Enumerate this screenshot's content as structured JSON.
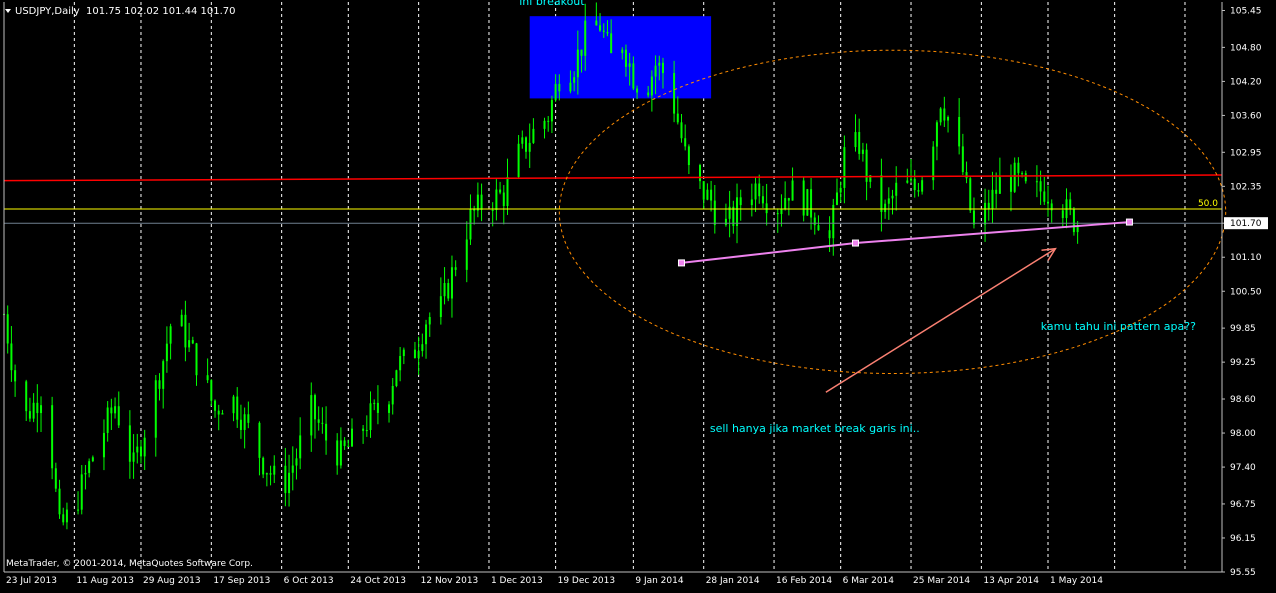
{
  "header": {
    "symbol_label": "USDJPY,Daily",
    "ohlc_label": "101.75 102.02 101.44 101.70"
  },
  "footer": {
    "copyright": "MetaTrader, © 2001-2014, MetaQuotes Software Corp."
  },
  "colors": {
    "background": "#000000",
    "grid": "#ffffff",
    "candles": "#00ff00",
    "breakout_box": "#0000ff",
    "resistance_line": "#ff0000",
    "fib_line": "#ffff00",
    "trendline": "#ee82ee",
    "ellipse": "#ff8c00",
    "arrow": "#fa8072",
    "annotation_text": "#00ffff",
    "axis_text": "#ffffff",
    "price_label_bg": "#ffffff",
    "price_label_text": "#000000"
  },
  "chart_data": {
    "type": "candlestick",
    "symbol": "USDJPY",
    "timeframe": "Daily",
    "ylim": [
      95.55,
      105.6
    ],
    "x_range": [
      "2013-07-23",
      "2014-06-17"
    ],
    "grid": true,
    "y_ticks": [
      "105.45",
      "104.80",
      "104.20",
      "103.60",
      "102.95",
      "102.35",
      "101.70",
      "101.10",
      "100.50",
      "99.85",
      "99.25",
      "98.60",
      "98.00",
      "97.40",
      "96.75",
      "96.15",
      "95.55"
    ],
    "x_ticks": [
      {
        "label": "23 Jul 2013",
        "date": "2013-07-23"
      },
      {
        "label": "11 Aug 2013",
        "date": "2013-08-11"
      },
      {
        "label": "29 Aug 2013",
        "date": "2013-08-29"
      },
      {
        "label": "17 Sep 2013",
        "date": "2013-09-17"
      },
      {
        "label": "6 Oct 2013",
        "date": "2013-10-06"
      },
      {
        "label": "24 Oct 2013",
        "date": "2013-10-24"
      },
      {
        "label": "12 Nov 2013",
        "date": "2013-11-12"
      },
      {
        "label": "1 Dec 2013",
        "date": "2013-12-01"
      },
      {
        "label": "19 Dec 2013",
        "date": "2013-12-19"
      },
      {
        "label": "9 Jan 2014",
        "date": "2014-01-09"
      },
      {
        "label": "28 Jan 2014",
        "date": "2014-01-28"
      },
      {
        "label": "16 Feb 2014",
        "date": "2014-02-16"
      },
      {
        "label": "6 Mar 2014",
        "date": "2014-03-06"
      },
      {
        "label": "25 Mar 2014",
        "date": "2014-03-25"
      },
      {
        "label": "13 Apr 2014",
        "date": "2014-04-13"
      },
      {
        "label": "1 May 2014",
        "date": "2014-05-01"
      }
    ],
    "current_price": "101.70",
    "price_path": [
      [
        "2013-07-23",
        100.1
      ],
      [
        "2013-07-28",
        98.2
      ],
      [
        "2013-08-03",
        98.8
      ],
      [
        "2013-08-07",
        96.3
      ],
      [
        "2013-08-11",
        96.7
      ],
      [
        "2013-08-16",
        97.6
      ],
      [
        "2013-08-22",
        98.5
      ],
      [
        "2013-08-27",
        97.4
      ],
      [
        "2013-08-31",
        98.3
      ],
      [
        "2013-09-04",
        99.3
      ],
      [
        "2013-09-07",
        100.2
      ],
      [
        "2013-09-10",
        99.7
      ],
      [
        "2013-09-14",
        99.1
      ],
      [
        "2013-09-18",
        98.4
      ],
      [
        "2013-09-22",
        98.7
      ],
      [
        "2013-09-26",
        98.2
      ],
      [
        "2013-10-01",
        97.5
      ],
      [
        "2013-10-06",
        97.0
      ],
      [
        "2013-10-10",
        97.6
      ],
      [
        "2013-10-14",
        98.4
      ],
      [
        "2013-10-18",
        97.9
      ],
      [
        "2013-10-22",
        97.6
      ],
      [
        "2013-10-26",
        97.9
      ],
      [
        "2013-10-30",
        98.3
      ],
      [
        "2013-11-03",
        98.5
      ],
      [
        "2013-11-06",
        99.2
      ],
      [
        "2013-11-10",
        99.3
      ],
      [
        "2013-11-14",
        100.0
      ],
      [
        "2013-11-18",
        100.2
      ],
      [
        "2013-11-22",
        101.0
      ],
      [
        "2013-11-26",
        101.8
      ],
      [
        "2013-11-30",
        102.1
      ],
      [
        "2013-12-05",
        102.2
      ],
      [
        "2013-12-09",
        102.9
      ],
      [
        "2013-12-13",
        103.3
      ],
      [
        "2013-12-17",
        103.6
      ],
      [
        "2013-12-20",
        104.3
      ],
      [
        "2013-12-24",
        104.5
      ],
      [
        "2013-12-27",
        105.0
      ],
      [
        "2013-12-31",
        105.2
      ],
      [
        "2014-01-03",
        104.6
      ],
      [
        "2014-01-06",
        104.9
      ],
      [
        "2014-01-09",
        104.3
      ],
      [
        "2014-01-12",
        104.0
      ],
      [
        "2014-01-15",
        104.5
      ],
      [
        "2014-01-18",
        104.3
      ],
      [
        "2014-01-21",
        103.5
      ],
      [
        "2014-01-24",
        102.6
      ],
      [
        "2014-01-27",
        102.3
      ],
      [
        "2014-01-30",
        102.1
      ],
      [
        "2014-02-02",
        101.6
      ],
      [
        "2014-02-05",
        101.8
      ],
      [
        "2014-02-08",
        102.2
      ],
      [
        "2014-02-12",
        102.4
      ],
      [
        "2014-02-16",
        101.9
      ],
      [
        "2014-02-20",
        102.3
      ],
      [
        "2014-02-24",
        102.1
      ],
      [
        "2014-02-28",
        101.8
      ],
      [
        "2014-03-03",
        101.4
      ],
      [
        "2014-03-07",
        102.9
      ],
      [
        "2014-03-11",
        103.1
      ],
      [
        "2014-03-14",
        102.3
      ],
      [
        "2014-03-18",
        101.9
      ],
      [
        "2014-03-22",
        102.4
      ],
      [
        "2014-03-26",
        102.3
      ],
      [
        "2014-03-30",
        102.9
      ],
      [
        "2014-04-02",
        103.9
      ],
      [
        "2014-04-05",
        103.4
      ],
      [
        "2014-04-08",
        102.6
      ],
      [
        "2014-04-11",
        101.6
      ],
      [
        "2014-04-14",
        101.9
      ],
      [
        "2014-04-18",
        102.4
      ],
      [
        "2014-04-22",
        102.5
      ],
      [
        "2014-04-26",
        102.2
      ],
      [
        "2014-04-30",
        102.3
      ],
      [
        "2014-05-04",
        102.1
      ],
      [
        "2014-05-07",
        101.8
      ],
      [
        "2014-05-09",
        101.7
      ]
    ],
    "breakout_zone": {
      "from": "2013-12-12",
      "to": "2014-01-30",
      "low": 103.9,
      "high": 105.35
    },
    "resistance_line": {
      "y_start": 102.45,
      "y_end": 102.55
    },
    "fib_line": {
      "y": 101.95,
      "label": "50.0"
    },
    "trendline": {
      "points": [
        [
          "2014-01-22",
          101.0
        ],
        [
          "2014-03-10",
          101.35
        ],
        [
          "2014-05-23",
          101.72
        ]
      ]
    },
    "ellipse": {
      "center_date": "2014-03-20",
      "center_price": 101.9,
      "x_radius_days": 90,
      "y_radius_price": 2.85
    },
    "arrow": {
      "from": [
        "2014-03-02",
        98.72
      ],
      "to": [
        "2014-05-03",
        101.25
      ]
    },
    "annotations": [
      {
        "text": "ini breakout",
        "date": "2013-12-18",
        "price": 105.55
      },
      {
        "text": "kamu tahu ini pattern apa??",
        "date": "2014-05-20",
        "price": 99.82
      },
      {
        "text": "sell hanya jika market break garis ini..",
        "date": "2014-02-27",
        "price": 98.02
      }
    ]
  }
}
